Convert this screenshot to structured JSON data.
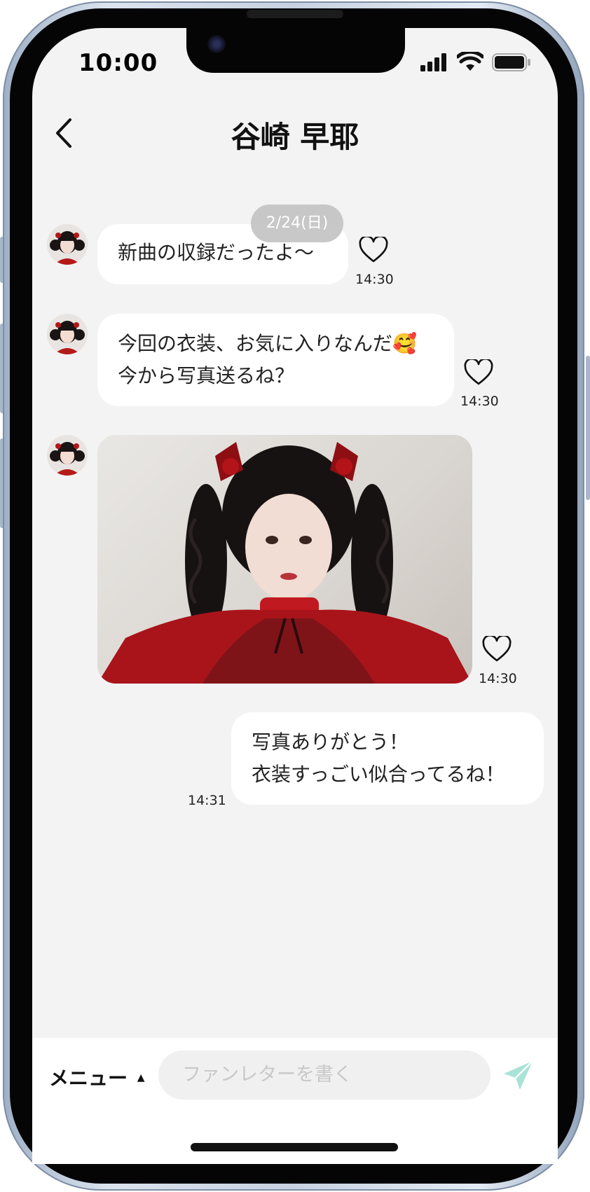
{
  "status_bar": {
    "time": "10:00"
  },
  "header": {
    "back_icon": "chevron-left-icon",
    "title": "谷崎 早耶"
  },
  "chat": {
    "date_label": "2/24(日)",
    "messages": [
      {
        "sender": "idol",
        "text": "新曲の収録だったよ〜",
        "time": "14:30",
        "liked": false
      },
      {
        "sender": "idol",
        "line1": "今回の衣装、お気に入りなんだ🥰",
        "line2": "今から写真送るね？",
        "time": "14:30",
        "liked": false
      },
      {
        "sender": "idol",
        "type": "image",
        "time": "14:30",
        "liked": false
      },
      {
        "sender": "me",
        "line1": "写真ありがとう！",
        "line2": "衣装すっごい似合ってるね！",
        "time": "14:31"
      }
    ]
  },
  "composer": {
    "menu_label": "メニュー",
    "menu_arrow": "▲",
    "placeholder": "ファンレターを書く",
    "send_icon": "send-icon"
  },
  "colors": {
    "send_accent": "#a8e3d6",
    "background": "#f3f3f3"
  }
}
